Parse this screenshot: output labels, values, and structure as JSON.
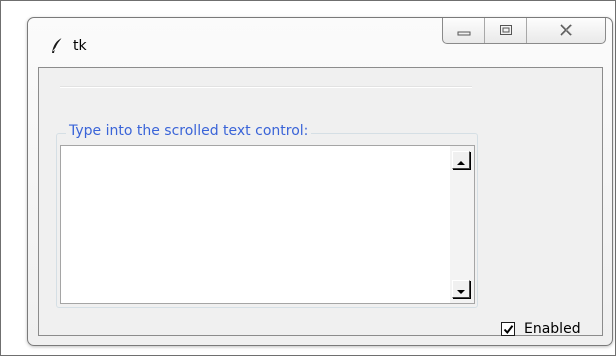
{
  "window": {
    "title": "tk"
  },
  "caption_buttons": {
    "minimize_icon": "minimize-icon",
    "maximize_icon": "restore-icon",
    "close_icon": "close-icon"
  },
  "labelframe": {
    "title": "Type into the scrolled text control:"
  },
  "scrolled_text": {
    "value": "",
    "scroll_up_icon": "arrow-up-icon",
    "scroll_down_icon": "arrow-down-icon"
  },
  "checkbox": {
    "label": "Enabled",
    "checked": true
  },
  "colors": {
    "labelframe_title": "#3a64d8",
    "client_background": "#f0f0f0"
  }
}
